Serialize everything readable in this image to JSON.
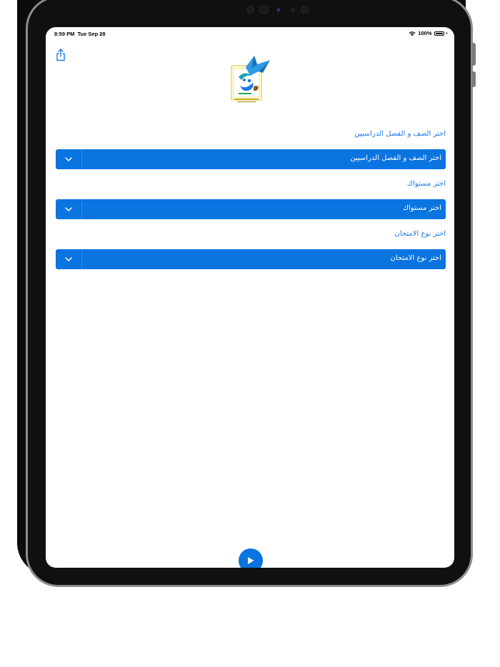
{
  "status_bar": {
    "time": "8:59 PM",
    "date": "Tue Sep 28",
    "battery_percent": "100%"
  },
  "icons": {
    "share": "share-icon",
    "wifi": "wifi-icon",
    "battery": "battery-icon",
    "chevron": "chevron-down-icon",
    "play": "play-icon",
    "logo": "app-logo"
  },
  "form": {
    "class_term": {
      "label": "اختر الصف و الفصل الدراسيين",
      "selected": "اختر الصف و الفصل الدراسيين"
    },
    "level": {
      "label": "اختر مستواك",
      "selected": "اختر مستواك"
    },
    "exam_type": {
      "label": "اختر نوع الامتحان",
      "selected": "اختر نوع الامتحان"
    }
  },
  "colors": {
    "accent": "#0A74E0",
    "label_text": "#1F7AE8",
    "bezel": "#101012"
  }
}
